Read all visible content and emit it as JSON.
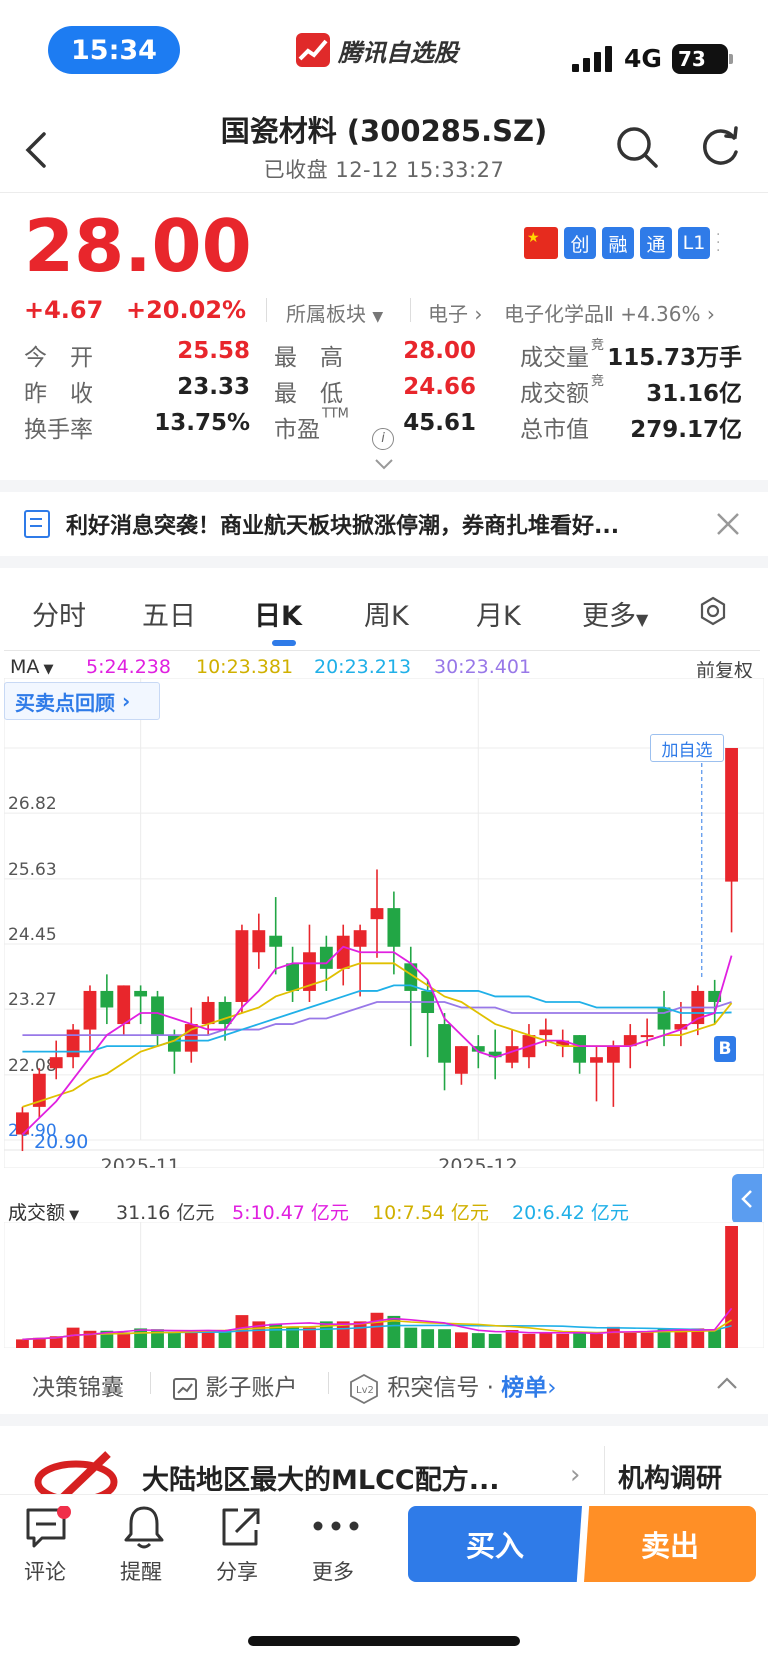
{
  "status": {
    "time": "15:34",
    "app_name": "腾讯自选股",
    "network": "4G",
    "battery": "73"
  },
  "header": {
    "title": "国瓷材料 (300285.SZ)",
    "subtitle": "已收盘   12-12 15:33:27"
  },
  "quote": {
    "price": "28.00",
    "change": "+4.67",
    "change_pct": "+20.02%",
    "sector_label": "所属板块",
    "sector_path": "电子",
    "subsector": "电子化学品Ⅱ",
    "subsector_pct": "+4.36%",
    "badges": [
      "创",
      "融",
      "通",
      "L1"
    ],
    "stats": [
      {
        "label": "今　开",
        "value": "25.58",
        "color": "red"
      },
      {
        "label": "最　高",
        "value": "28.00",
        "color": "red"
      },
      {
        "label": "成交量",
        "sup": "竞",
        "value": "115.73万手",
        "color": "black"
      },
      {
        "label": "昨　收",
        "value": "23.33",
        "color": "black"
      },
      {
        "label": "最　低",
        "value": "24.66",
        "color": "red"
      },
      {
        "label": "成交额",
        "sup": "竞",
        "value": "31.16亿",
        "color": "black"
      },
      {
        "label": "换手率",
        "value": "13.75%",
        "color": "black"
      },
      {
        "label": "市盈",
        "sup": "TTM",
        "value": "45.61",
        "color": "black"
      },
      {
        "label": "总市值",
        "value": "279.17亿",
        "color": "black"
      }
    ]
  },
  "news": {
    "text": "利好消息突袭！商业航天板块掀涨停潮，券商扎堆看好..."
  },
  "tabs": [
    "分时",
    "五日",
    "日K",
    "周K",
    "月K",
    "更多"
  ],
  "ma": {
    "label": "MA",
    "ma5": "5:24.238",
    "ma10": "10:23.381",
    "ma20": "20:23.213",
    "ma30": "30:23.401",
    "adjust": "前复权"
  },
  "buy_sell_review": "买卖点回顾",
  "add_watch": "加自选",
  "b_marker": "B",
  "chart_data": {
    "type": "candlestick",
    "y_ticks": [
      "26.82",
      "25.63",
      "24.45",
      "23.27",
      "22.08",
      "20.90"
    ],
    "ylim": [
      20.9,
      28.0
    ],
    "x_ticks": [
      "2025-11",
      "2025-12"
    ],
    "high_label": "28.00",
    "low_label": "20.90",
    "candles": [
      [
        21.0,
        21.4,
        20.7,
        21.5
      ],
      [
        21.5,
        22.1,
        21.3,
        22.2
      ],
      [
        22.2,
        22.4,
        22.0,
        22.7
      ],
      [
        22.4,
        22.9,
        22.2,
        23.0
      ],
      [
        22.9,
        23.6,
        22.5,
        23.7
      ],
      [
        23.6,
        23.3,
        23.0,
        23.9
      ],
      [
        23.0,
        23.7,
        22.8,
        23.7
      ],
      [
        23.6,
        23.5,
        23.0,
        23.7
      ],
      [
        23.5,
        22.8,
        22.6,
        23.6
      ],
      [
        22.8,
        22.5,
        22.1,
        22.9
      ],
      [
        22.5,
        23.0,
        22.3,
        23.3
      ],
      [
        23.0,
        23.4,
        22.8,
        23.5
      ],
      [
        23.4,
        23.0,
        22.7,
        23.5
      ],
      [
        23.4,
        24.7,
        23.2,
        24.8
      ],
      [
        24.3,
        24.7,
        24.0,
        25.0
      ],
      [
        24.6,
        24.4,
        23.9,
        25.3
      ],
      [
        24.1,
        23.6,
        23.4,
        24.4
      ],
      [
        23.6,
        24.3,
        23.4,
        24.8
      ],
      [
        24.4,
        24.0,
        23.6,
        24.6
      ],
      [
        24.0,
        24.6,
        23.7,
        24.8
      ],
      [
        24.4,
        24.7,
        23.5,
        24.8
      ],
      [
        24.9,
        25.1,
        24.2,
        25.8
      ],
      [
        25.1,
        24.4,
        23.9,
        25.4
      ],
      [
        24.1,
        23.6,
        22.6,
        24.4
      ],
      [
        23.6,
        23.2,
        22.4,
        23.8
      ],
      [
        23.0,
        22.3,
        21.8,
        23.2
      ],
      [
        22.1,
        22.6,
        21.9,
        22.6
      ],
      [
        22.6,
        22.5,
        22.2,
        22.8
      ],
      [
        22.5,
        22.4,
        22.0,
        22.9
      ],
      [
        22.3,
        22.6,
        22.2,
        22.9
      ],
      [
        22.4,
        22.8,
        22.2,
        23.0
      ],
      [
        22.8,
        22.9,
        22.6,
        23.1
      ],
      [
        22.6,
        22.7,
        22.4,
        22.9
      ],
      [
        22.8,
        22.3,
        22.1,
        22.8
      ],
      [
        22.3,
        22.4,
        21.6,
        22.6
      ],
      [
        22.3,
        22.6,
        21.5,
        22.7
      ],
      [
        22.6,
        22.8,
        22.2,
        23.0
      ],
      [
        22.8,
        22.8,
        22.6,
        23.1
      ],
      [
        23.3,
        22.9,
        22.6,
        23.6
      ],
      [
        22.9,
        23.0,
        22.6,
        23.4
      ],
      [
        23.0,
        23.6,
        22.8,
        23.7
      ],
      [
        23.6,
        23.4,
        23.0,
        23.8
      ],
      [
        25.58,
        28.0,
        24.66,
        28.0
      ]
    ],
    "ma5": [
      21.0,
      21.3,
      21.6,
      22.0,
      22.4,
      22.8,
      23.0,
      23.2,
      23.2,
      23.1,
      23.0,
      22.9,
      22.9,
      23.3,
      23.6,
      24.0,
      24.1,
      24.1,
      24.1,
      24.4,
      24.3,
      24.3,
      24.3,
      24.1,
      23.8,
      23.1,
      22.8,
      22.5,
      22.4,
      22.5,
      22.6,
      22.7,
      22.7,
      22.6,
      22.6,
      22.6,
      22.6,
      22.7,
      22.8,
      22.9,
      23.1,
      23.2,
      24.24
    ],
    "ma10": [
      21.5,
      21.6,
      21.7,
      21.8,
      22.0,
      22.1,
      22.3,
      22.5,
      22.6,
      22.7,
      22.9,
      23.0,
      23.1,
      23.2,
      23.3,
      23.5,
      23.6,
      23.7,
      23.8,
      24.0,
      24.1,
      24.1,
      24.1,
      23.9,
      23.7,
      23.5,
      23.4,
      23.2,
      23.0,
      22.9,
      22.8,
      22.7,
      22.6,
      22.6,
      22.6,
      22.6,
      22.6,
      22.7,
      22.8,
      22.8,
      22.9,
      23.0,
      23.38
    ],
    "ma20": [
      22.5,
      22.5,
      22.5,
      22.5,
      22.5,
      22.6,
      22.6,
      22.6,
      22.6,
      22.7,
      22.7,
      22.7,
      22.8,
      22.9,
      23.0,
      23.1,
      23.2,
      23.3,
      23.4,
      23.5,
      23.6,
      23.6,
      23.7,
      23.7,
      23.6,
      23.6,
      23.6,
      23.6,
      23.5,
      23.5,
      23.5,
      23.4,
      23.4,
      23.4,
      23.3,
      23.3,
      23.3,
      23.3,
      23.3,
      23.2,
      23.2,
      23.2,
      23.21
    ],
    "ma30": [
      22.8,
      22.8,
      22.8,
      22.8,
      22.8,
      22.8,
      22.8,
      22.8,
      22.8,
      22.8,
      22.8,
      22.8,
      22.9,
      22.9,
      22.9,
      23.0,
      23.0,
      23.1,
      23.1,
      23.2,
      23.3,
      23.4,
      23.4,
      23.4,
      23.4,
      23.4,
      23.3,
      23.3,
      23.3,
      23.2,
      23.2,
      23.2,
      23.2,
      23.2,
      23.2,
      23.2,
      23.2,
      23.2,
      23.2,
      23.3,
      23.3,
      23.3,
      23.4
    ]
  },
  "volume": {
    "label": "成交额",
    "total": "31.16 亿元",
    "ma5": "5:10.47 亿元",
    "ma10": "10:7.54 亿元",
    "ma20": "20:6.42 亿元",
    "values": [
      2.2,
      2.6,
      3.0,
      5.2,
      4.4,
      4.4,
      4.0,
      5.0,
      4.8,
      4.1,
      4.2,
      4.4,
      4.5,
      8.4,
      6.8,
      6.2,
      5.4,
      5.2,
      6.8,
      6.8,
      6.8,
      9.0,
      8.2,
      5.2,
      4.8,
      4.8,
      4.0,
      3.8,
      3.6,
      4.6,
      3.6,
      4.0,
      3.6,
      3.8,
      3.6,
      5.4,
      4.2,
      4.0,
      5.0,
      4.6,
      5.0,
      4.8,
      31.16
    ]
  },
  "tools": {
    "t1": "决策锦囊",
    "t2": "影子账户",
    "t3": "积突信号 · ",
    "t3b": "榜单"
  },
  "promo": {
    "text": "大陆地区最大的MLCC配方...",
    "right": "机构调研"
  },
  "bottom": {
    "comment": "评论",
    "alert": "提醒",
    "share": "分享",
    "more": "更多",
    "buy": "买入",
    "sell": "卖出"
  },
  "colors": {
    "up": "#e8262c",
    "down": "#22a645",
    "accent": "#2f7be8",
    "sell": "#ff8f26",
    "ma5": "#e020e0",
    "ma10": "#e0c000",
    "ma20": "#20b0e8",
    "ma30": "#9878e8"
  }
}
